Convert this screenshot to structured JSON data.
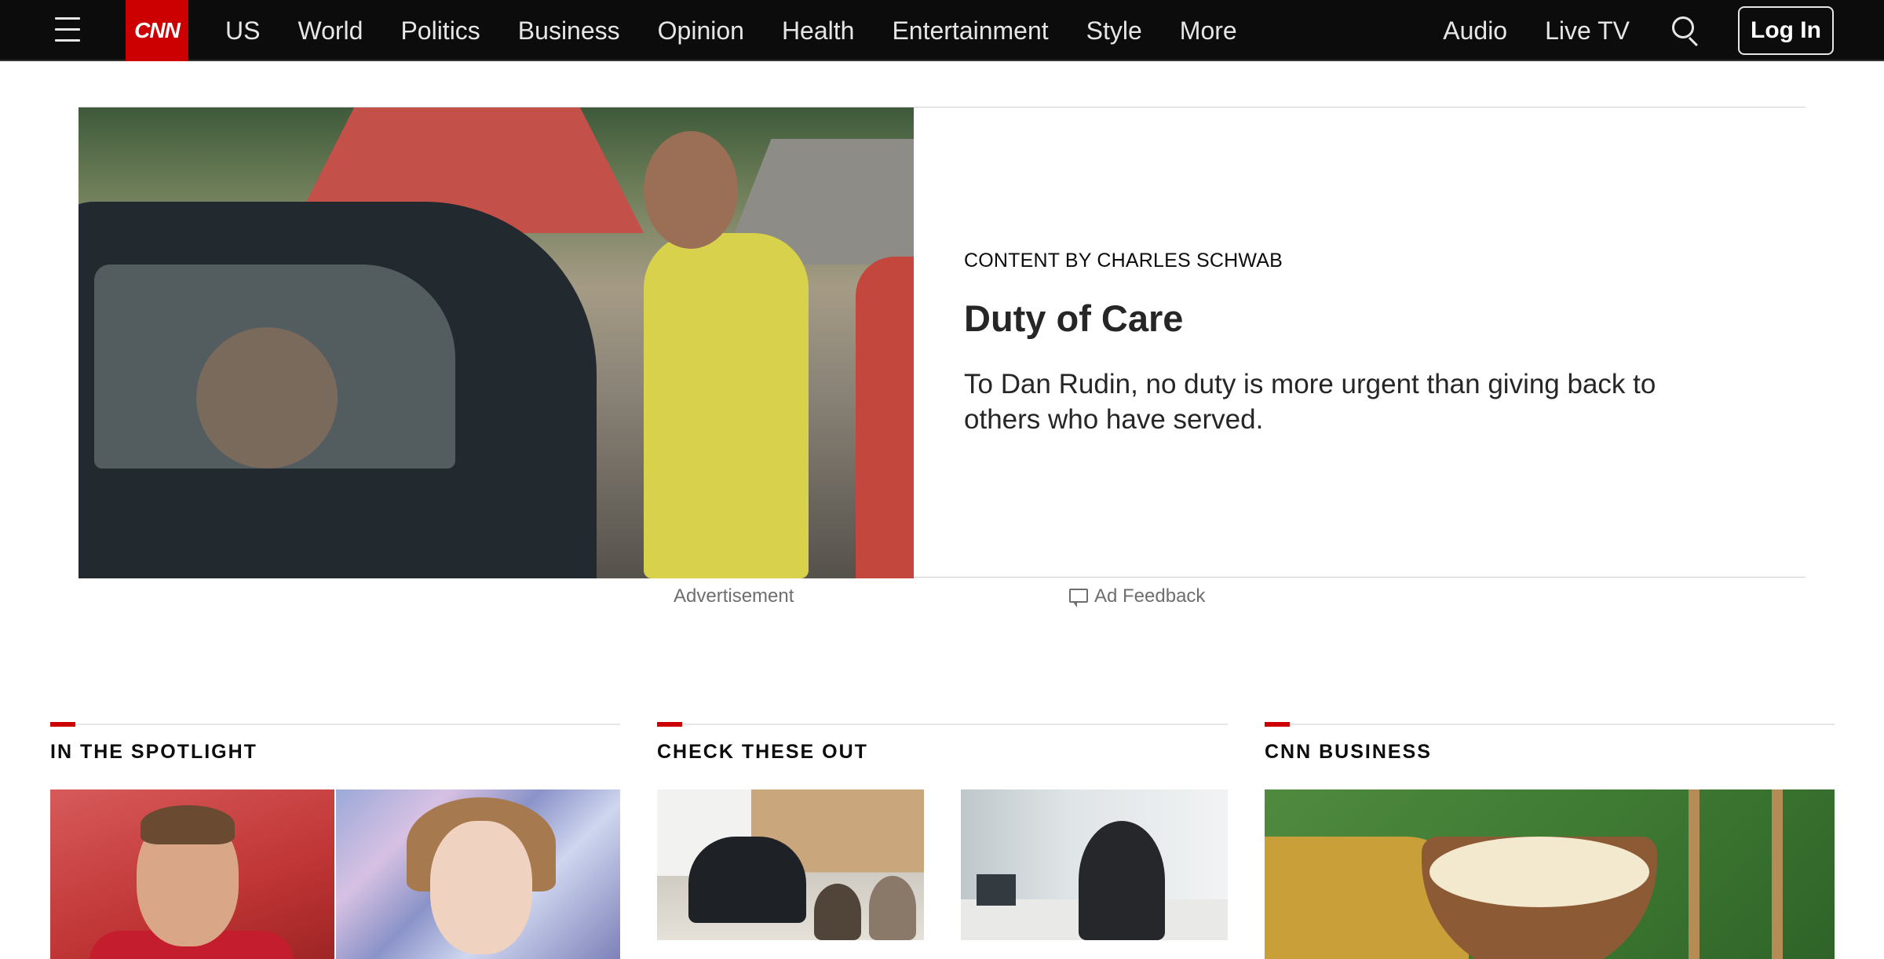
{
  "header": {
    "logo_text": "CNN",
    "nav": [
      "US",
      "World",
      "Politics",
      "Business",
      "Opinion",
      "Health",
      "Entertainment",
      "Style",
      "More"
    ],
    "right_links": [
      "Audio",
      "Live TV"
    ],
    "login_label": "Log In"
  },
  "ad": {
    "sponsor": "CONTENT BY CHARLES SCHWAB",
    "headline": "Duty of Care",
    "description": "To Dan Rudin, no duty is more urgent than giving back to others who have served.",
    "label": "Advertisement",
    "feedback": "Ad Feedback"
  },
  "sections": {
    "spotlight": {
      "title": "IN THE SPOTLIGHT"
    },
    "check": {
      "title": "CHECK THESE OUT"
    },
    "business": {
      "title": "CNN BUSINESS"
    }
  },
  "colors": {
    "brand_red": "#cc0000",
    "nav_bg": "#0c0c0c",
    "nav_text": "#e6e6e6",
    "muted_text": "#6e6e6e"
  },
  "icons": [
    "hamburger-menu-icon",
    "search-icon",
    "ad-feedback-icon"
  ]
}
